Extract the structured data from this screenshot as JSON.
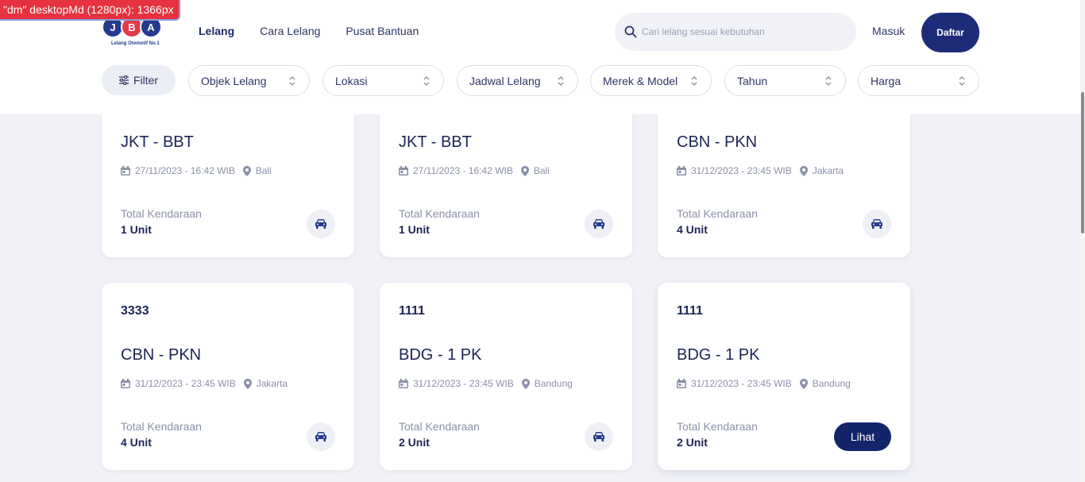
{
  "debug_badge": "\"dm\" desktopMd (1280px): 1366px",
  "logo": {
    "letters": [
      "J",
      "B",
      "A"
    ],
    "tagline": "Lelang Otomotif No.1"
  },
  "nav": [
    {
      "label": "Lelang",
      "active": true
    },
    {
      "label": "Cara Lelang",
      "active": false
    },
    {
      "label": "Pusat Bantuan",
      "active": false
    }
  ],
  "search": {
    "placeholder": "Cari lelang sesuai kebutuhan",
    "icon": "search-icon"
  },
  "auth": {
    "login_label": "Masuk",
    "register_label": "Daftar"
  },
  "filters": {
    "filter_label": "Filter",
    "dropdowns": [
      "Objek Lelang",
      "Lokasi",
      "Jadwal Lelang",
      "Merek & Model",
      "Tahun",
      "Harga"
    ]
  },
  "cards": [
    {
      "code": "",
      "route": "JKT - BBT",
      "datetime": "27/11/2023 - 16:42 WIB",
      "location": "Bali",
      "total_label": "Total Kendaraan",
      "total": "1 Unit",
      "action": "car-icon"
    },
    {
      "code": "",
      "route": "JKT - BBT",
      "datetime": "27/11/2023 - 16:42 WIB",
      "location": "Bali",
      "total_label": "Total Kendaraan",
      "total": "1 Unit",
      "action": "car-icon"
    },
    {
      "code": "",
      "route": "CBN - PKN",
      "datetime": "31/12/2023 - 23:45 WIB",
      "location": "Jakarta",
      "total_label": "Total Kendaraan",
      "total": "4 Unit",
      "action": "car-icon"
    },
    {
      "code": "3333",
      "route": "CBN - PKN",
      "datetime": "31/12/2023 - 23:45 WIB",
      "location": "Jakarta",
      "total_label": "Total Kendaraan",
      "total": "4 Unit",
      "action": "car-icon"
    },
    {
      "code": "1111",
      "route": "BDG - 1 PK",
      "datetime": "31/12/2023 - 23:45 WIB",
      "location": "Bandung",
      "total_label": "Total Kendaraan",
      "total": "2 Unit",
      "action": "car-icon"
    },
    {
      "code": "1111",
      "route": "BDG - 1 PK",
      "datetime": "31/12/2023 - 23:45 WIB",
      "location": "Bandung",
      "total_label": "Total Kendaraan",
      "total": "2 Unit",
      "action": "Lihat"
    }
  ],
  "colors": {
    "primary": "#1e2b78",
    "accent_red": "#e23b4a",
    "background": "#f1f2f7"
  }
}
